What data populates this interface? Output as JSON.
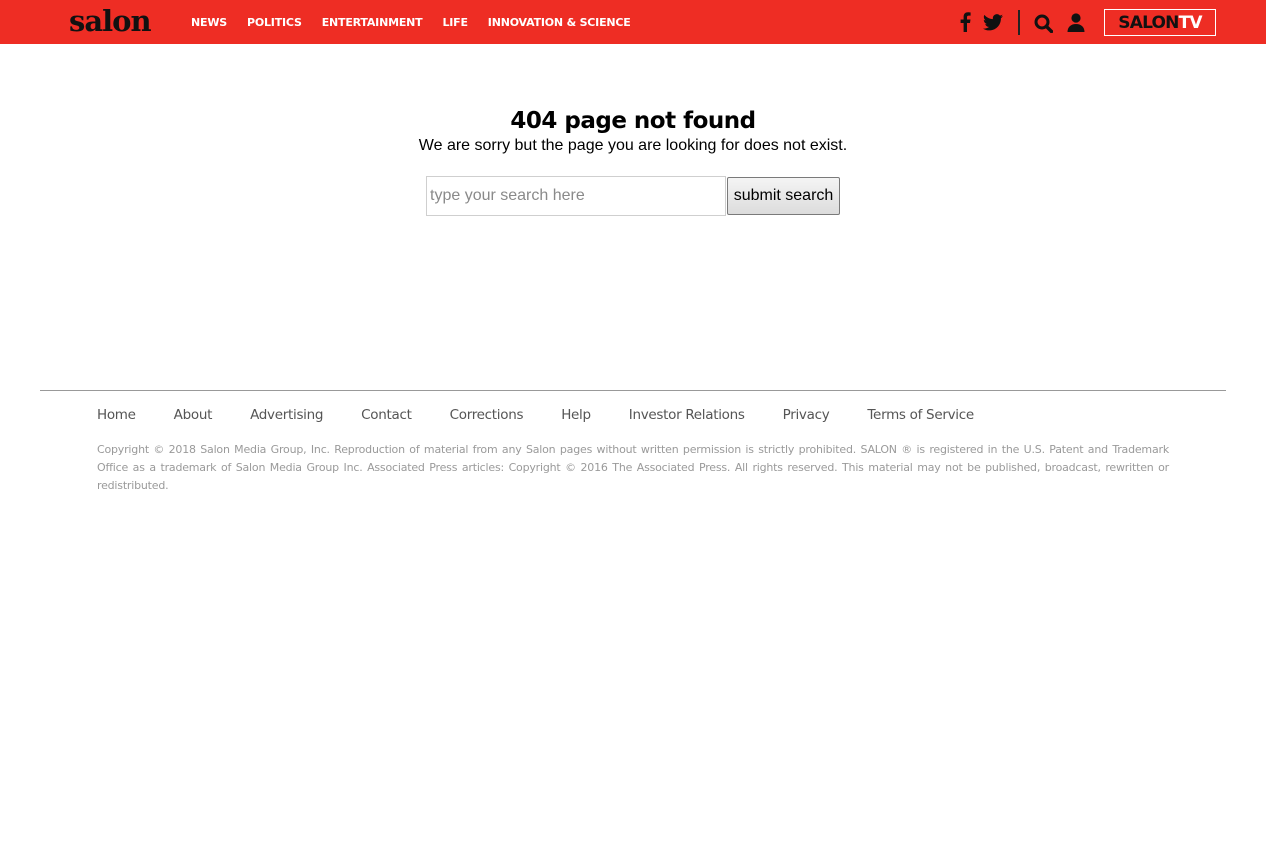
{
  "header": {
    "logo": "salon",
    "nav": [
      "NEWS",
      "POLITICS",
      "ENTERTAINMENT",
      "LIFE",
      "INNOVATION & SCIENCE"
    ],
    "icons": [
      "facebook-icon",
      "twitter-icon",
      "search-icon",
      "user-icon"
    ],
    "salontv": {
      "part1": "SALON",
      "part2": "TV"
    },
    "bg_color": "#ee2d24"
  },
  "main": {
    "title": "404 page not found",
    "message": "We are sorry but the page you are looking for does not exist.",
    "search": {
      "placeholder": "type your search here",
      "value": "",
      "button_label": "submit search"
    }
  },
  "footer": {
    "links": [
      "Home",
      "About",
      "Advertising",
      "Contact",
      "Corrections",
      "Help",
      "Investor Relations",
      "Privacy",
      "Terms of Service"
    ],
    "copyright": "Copyright © 2018 Salon Media Group, Inc. Reproduction of material from any Salon pages without written permission is strictly prohibited. SALON ® is registered in the U.S. Patent and Trademark Office as a trademark of Salon Media Group Inc. Associated Press articles: Copyright © 2016 The Associated Press. All rights reserved. This material may not be published, broadcast, rewritten or redistributed."
  }
}
